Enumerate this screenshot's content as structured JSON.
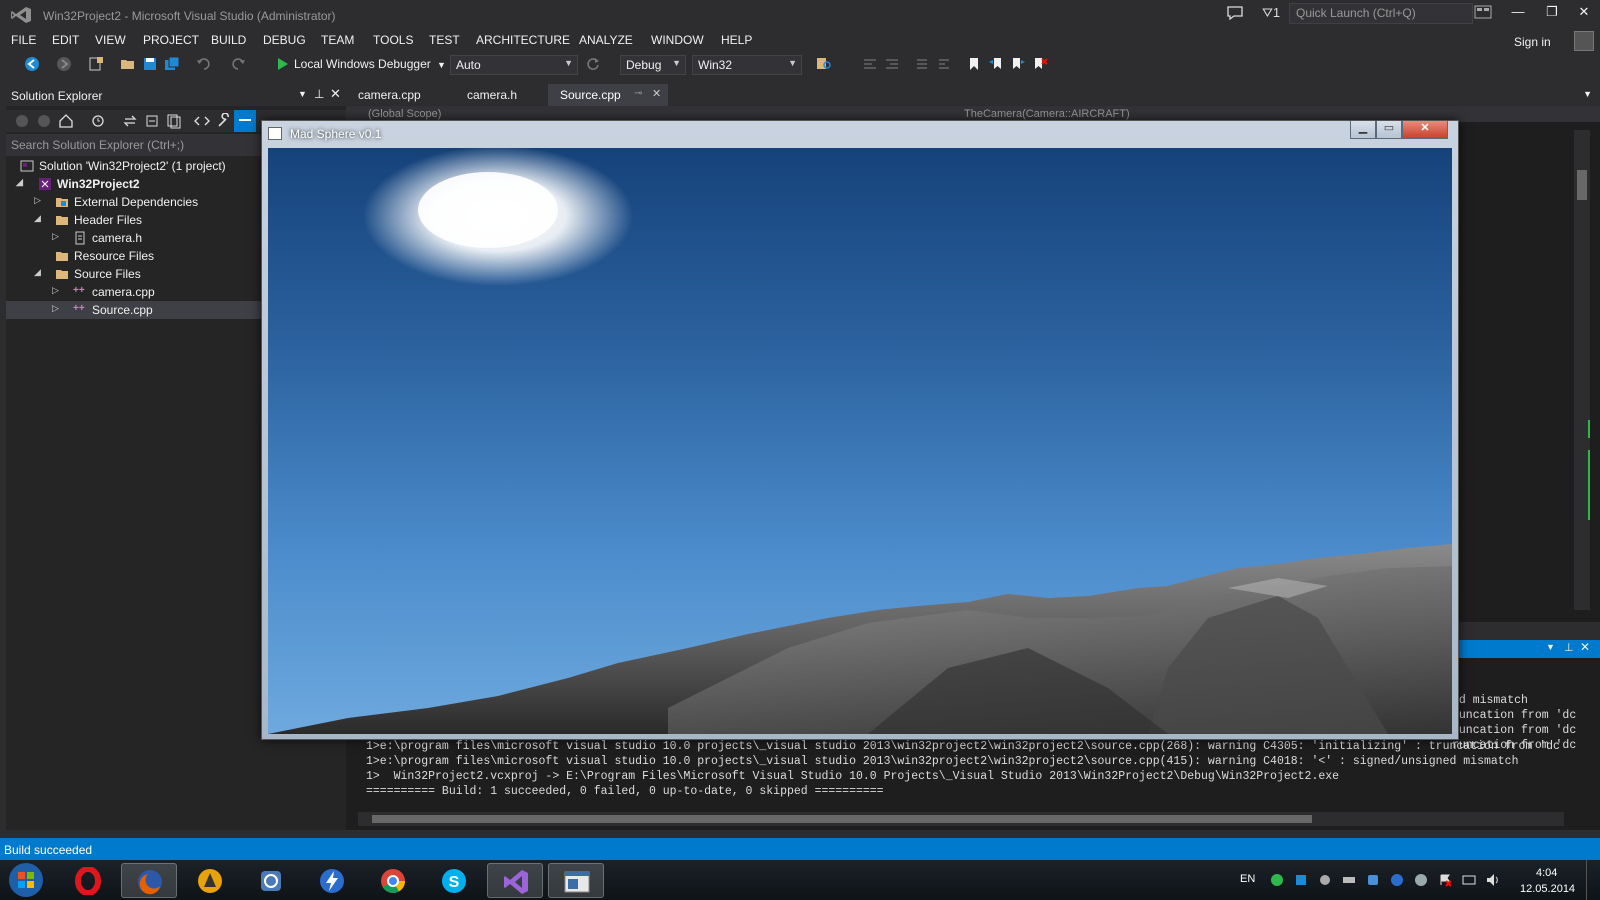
{
  "window": {
    "title": "Win32Project2 - Microsoft Visual Studio (Administrator)",
    "notification_count": "1",
    "quick_launch_placeholder": "Quick Launch (Ctrl+Q)",
    "minimize": "—",
    "restore": "❐",
    "close": "✕"
  },
  "menu": [
    "FILE",
    "EDIT",
    "VIEW",
    "PROJECT",
    "BUILD",
    "DEBUG",
    "TEAM",
    "TOOLS",
    "TEST",
    "ARCHITECTURE",
    "ANALYZE",
    "WINDOW",
    "HELP"
  ],
  "account": {
    "sign_in": "Sign in"
  },
  "toolbar": {
    "debugger": "Local Windows Debugger",
    "solution_config_auto": "Auto",
    "configuration": "Debug",
    "platform": "Win32"
  },
  "solution_explorer": {
    "title": "Solution Explorer",
    "search_placeholder": "Search Solution Explorer (Ctrl+;)",
    "items": [
      {
        "label": "Solution 'Win32Project2' (1 project)",
        "icon": "solution-icon"
      },
      {
        "label": "Win32Project2",
        "icon": "project-icon"
      },
      {
        "label": "External Dependencies",
        "icon": "folder-icon"
      },
      {
        "label": "Header Files",
        "icon": "folder-icon"
      },
      {
        "label": "camera.h",
        "icon": "header-file-icon"
      },
      {
        "label": "Resource Files",
        "icon": "folder-icon"
      },
      {
        "label": "Source Files",
        "icon": "folder-icon"
      },
      {
        "label": "camera.cpp",
        "icon": "cpp-file-icon"
      },
      {
        "label": "Source.cpp",
        "icon": "cpp-file-icon"
      }
    ]
  },
  "editor": {
    "tabs": [
      "camera.cpp",
      "camera.h",
      "Source.cpp"
    ],
    "scope": "(Global Scope)",
    "member": "TheCamera(Camera::AIRCRAFT)"
  },
  "output": {
    "lines": [
      "1>e:\\program files\\microsoft visual studio 10.0 projects\\_visual studio 2013\\win32project2\\win32project2\\source.cpp(268): warning C4305: 'initializing' : truncation from 'dc",
      "1>e:\\program files\\microsoft visual studio 10.0 projects\\_visual studio 2013\\win32project2\\win32project2\\source.cpp(415): warning C4018: '<' : signed/unsigned mismatch",
      "1>  Win32Project2.vcxproj -> E:\\Program Files\\Microsoft Visual Studio 10.0 Projects\\_Visual Studio 2013\\Win32Project2\\Debug\\Win32Project2.exe",
      "========== Build: 1 succeeded, 0 failed, 0 up-to-date, 0 skipped =========="
    ],
    "visible_right_fragments": [
      "ed mismatch",
      "runcation from 'dc",
      "runcation from 'dc",
      "runcation from 'dc"
    ]
  },
  "status": {
    "text": "Build succeeded"
  },
  "game_window": {
    "title": "Mad Sphere v0.1"
  },
  "taskbar": {
    "apps": [
      "windows-start-icon",
      "opera-icon",
      "firefox-icon",
      "vlc-icon",
      "app-icon",
      "flash-icon",
      "chrome-icon",
      "skype-icon",
      "visual-studio-icon",
      "window-app-icon"
    ],
    "language": "EN",
    "time": "4:04",
    "date": "12.05.2014"
  },
  "colors": {
    "accent": "#007acc",
    "background": "#2d2d30",
    "panel": "#252526",
    "editor": "#1e1e1e"
  }
}
